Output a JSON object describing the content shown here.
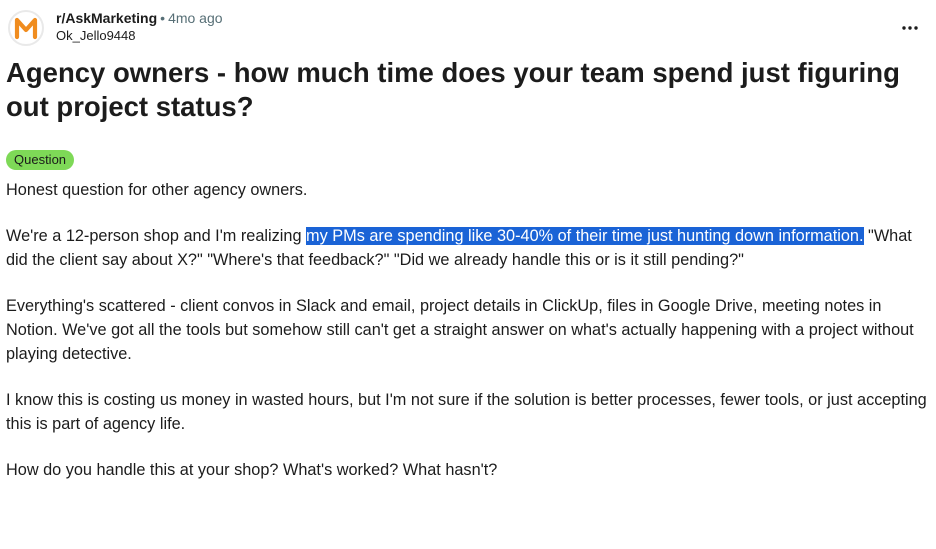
{
  "post": {
    "subreddit": "r/AskMarketing",
    "separator": "•",
    "age": "4mo ago",
    "author": "Ok_Jello9448",
    "title": "Agency owners - how much time does your team spend just figuring out project status?",
    "flair": "Question",
    "flair_color": "#7ed957",
    "paragraphs": {
      "p1": "Honest question for other agency owners.",
      "p2_before": "We're a 12-person shop and I'm realizing ",
      "p2_selected": "my PMs are spending like 30-40% of their time just hunting down information.",
      "p2_after": " \"What did the client say about X?\" \"Where's that feedback?\" \"Did we already handle this or is it still pending?\"",
      "p3": "Everything's scattered - client convos in Slack and email, project details in ClickUp, files in Google Drive, meeting notes in Notion. We've got all the tools but somehow still can't get a straight answer on what's actually happening with a project without playing detective.",
      "p4": "I know this is costing us money in wasted hours, but I'm not sure if the solution is better processes, fewer tools, or just accepting this is part of agency life.",
      "p5": "How do you handle this at your shop? What's worked? What hasn't?"
    }
  },
  "icons": {
    "avatar": "orange-m-logo-icon",
    "menu": "more-options-icon"
  },
  "colors": {
    "selection": "#1a63d6",
    "muted_text": "#576f76",
    "logo_orange": "#f08c1e"
  }
}
